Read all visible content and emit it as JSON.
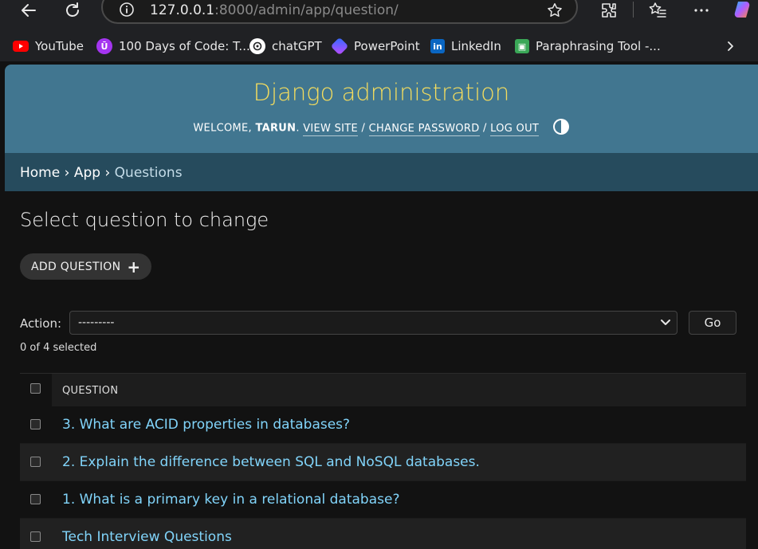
{
  "browser": {
    "url_host": "127.0.0.1",
    "url_rest": ":8000/admin/app/question/",
    "bookmarks": [
      {
        "label": "YouTube",
        "icon": "youtube-icon",
        "color": "#ff0000"
      },
      {
        "label": "100 Days of Code: T...",
        "icon": "udemy-icon",
        "color": "#a435f0"
      },
      {
        "label": "chatGPT",
        "icon": "chatgpt-icon",
        "color": "#ffffff"
      },
      {
        "label": "PowerPoint",
        "icon": "powerpoint-icon",
        "color": "#6b5bff"
      },
      {
        "label": "LinkedIn",
        "icon": "linkedin-icon",
        "color": "#0a66c2"
      },
      {
        "label": "Paraphrasing Tool -...",
        "icon": "quillbot-icon",
        "color": "#3aa757"
      }
    ]
  },
  "header": {
    "branding": "Django administration",
    "welcome": "WELCOME,",
    "username": "TARUN",
    "view_site": "VIEW SITE",
    "change_password": "CHANGE PASSWORD",
    "log_out": "LOG OUT",
    "sep": "/"
  },
  "breadcrumbs": {
    "home": "Home",
    "app": "App",
    "current": "Questions",
    "sep": "›"
  },
  "content": {
    "title": "Select question to change",
    "add_button": "ADD QUESTION",
    "action_label": "Action:",
    "action_value": "---------",
    "go_button": "Go",
    "selected_count": "0 of 4 selected",
    "column_header": "QUESTION",
    "rows": [
      "3. What are ACID properties in databases?",
      "2. Explain the difference between SQL and NoSQL databases.",
      "1. What is a primary key in a relational database?",
      "Tech Interview Questions"
    ]
  },
  "colors": {
    "header_bg": "#417690",
    "branding": "#f5dd5d",
    "breadcrumbs_bg": "#264b5d",
    "link": "#81d4fa"
  }
}
